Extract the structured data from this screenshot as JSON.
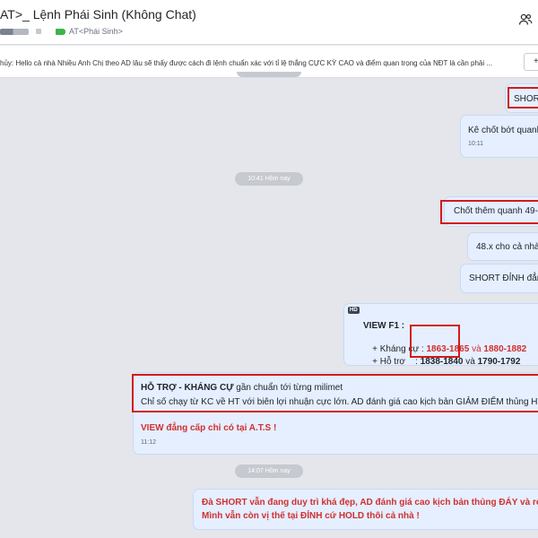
{
  "header": {
    "title": "AT>_ Lệnh Phái Sinh (Không Chat)",
    "group_name": "AT<Phái Sinh>"
  },
  "pinned": {
    "text": "hủy: Hello cả nhà Nhiều Anh Chị theo AD lâu sẽ thấy được cách đi lệnh chuẩn xác với tỉ lệ thắng CỰC KỲ CAO và điểm quan trọng của NĐT là cần phải ...",
    "button_label": "+"
  },
  "messages": {
    "m1_text": "SHORT",
    "m2_text": "Kê chốt bớt quanh",
    "m2_time": "10:11",
    "sep1": "10:41 Hôm nay",
    "m3_text": "Chốt thêm quanh 49-",
    "m4_text": "48.x cho cả nhà.",
    "m5_text": "SHORT ĐỈNH đẳng",
    "view": {
      "hd_badge": "HD",
      "title": "VIEW F1 :",
      "line1_prefix": "+ Kháng cự : ",
      "line1_v1": "1863-1865",
      "line1_mid": " và ",
      "line1_v2": "1880-1882",
      "line2_prefix": "+ Hỗ trợ    : ",
      "line2_v1": "1838-1840",
      "line2_mid": " và ",
      "line2_v2": "1790-1792"
    },
    "m7": {
      "heading_bold": "HỖ TRỢ - KHÁNG CỰ",
      "heading_rest": " gần chuẩn tới từng milimet",
      "line2": "Chỉ số chạy từ KC về HT với biên lợi nhuận cực lớn. AD đánh giá cao kịch bản GIẢM ĐIỂM thủng HT gã",
      "line3": "VIEW đẳng cấp chỉ có tại A.T.S !",
      "time": "11:12"
    },
    "sep2": "14:07 Hôm nay",
    "m8": {
      "line1": "Đà SHORT vẫn đang duy trì khá đẹp, AD đánh giá cao kịch bản thủng ĐÁY và rơi mạn",
      "line2": "Mình vẫn còn vị thế tại ĐỈNH cứ HOLD thôi cả nhà !"
    }
  },
  "colors": {
    "accent_red": "#d12f2f",
    "highlight_border": "#d31a1a",
    "bubble_bg": "#e5efff",
    "chat_bg": "#e4e6eb"
  },
  "icons": {
    "members": "people-icon",
    "group_tag": "tag-icon"
  }
}
